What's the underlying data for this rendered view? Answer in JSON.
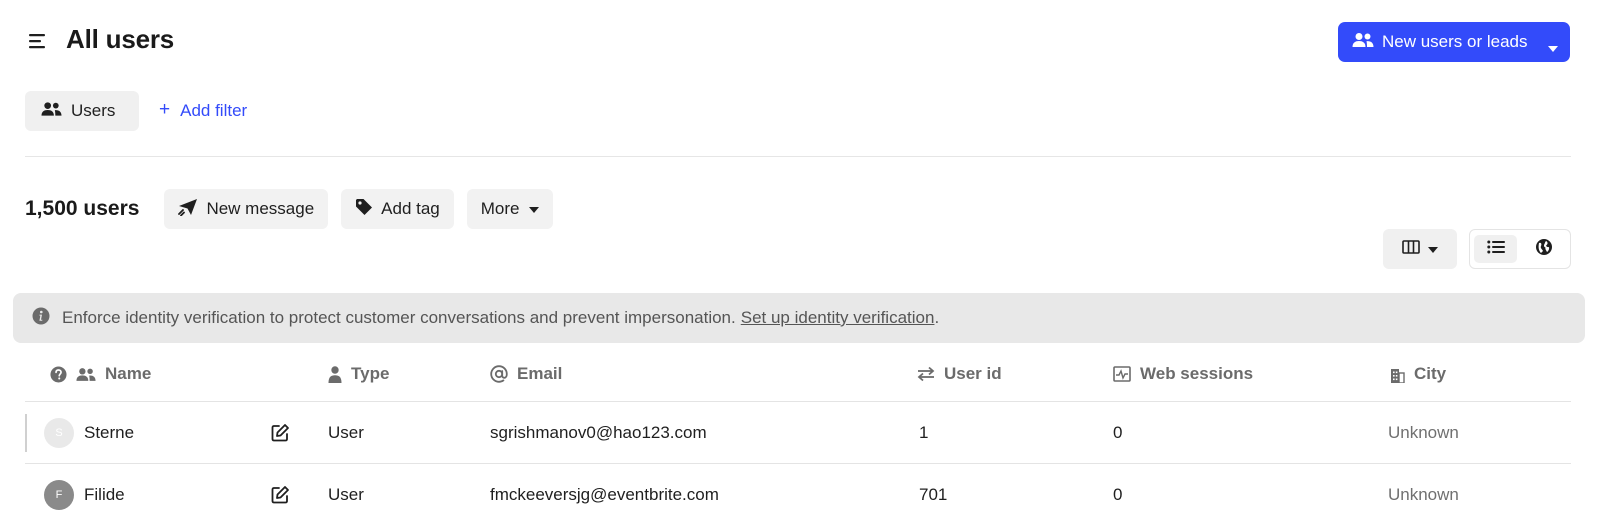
{
  "header": {
    "title": "All users",
    "primary_button": "New users or leads"
  },
  "filters": {
    "chip_label": "Users",
    "add_filter": "Add filter",
    "add_filter_prefix": "+"
  },
  "actions": {
    "count": "1,500 users",
    "new_message": "New message",
    "add_tag": "Add tag",
    "more": "More"
  },
  "banner": {
    "text": "Enforce identity verification to protect customer conversations and prevent impersonation.",
    "link": "Set up identity verification",
    "suffix": "."
  },
  "table": {
    "columns": [
      "Name",
      "Type",
      "Email",
      "User id",
      "Web sessions",
      "City"
    ],
    "rows": [
      {
        "initial": "S",
        "name": "Sterne",
        "type": "User",
        "email": "sgrishmanov0@hao123.com",
        "user_id": "1",
        "web_sessions": "0",
        "city": "Unknown"
      },
      {
        "initial": "F",
        "name": "Filide",
        "type": "User",
        "email": "fmckeeversjg@eventbrite.com",
        "user_id": "701",
        "web_sessions": "0",
        "city": "Unknown"
      }
    ]
  },
  "colors": {
    "accent": "#334bfa",
    "chip_bg": "#f0f0f0",
    "banner_bg": "#e8e8e8"
  },
  "icons": {
    "menu": "hamburger-menu-icon",
    "users": "users-group-icon",
    "message": "paper-plane-icon",
    "tag": "tag-icon",
    "columns": "columns-icon",
    "list": "list-view-icon",
    "globe": "globe-icon",
    "info": "info-icon",
    "help": "question-circle-icon",
    "edit": "edit-icon"
  }
}
